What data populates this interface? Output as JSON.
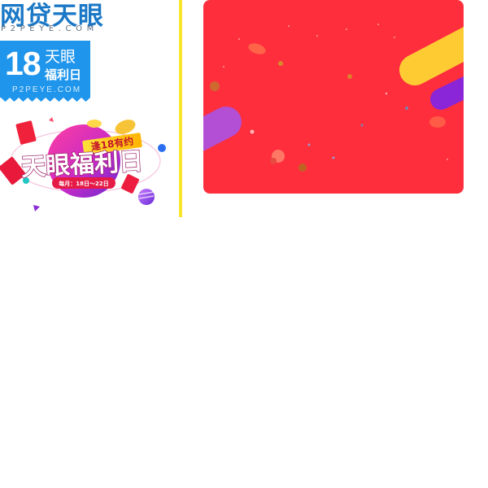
{
  "logo": {
    "main_text": "网贷天眼",
    "sub_text": "P2PEYE.COM"
  },
  "badge": {
    "number": "18",
    "line1": "天眼",
    "line2": "福利日",
    "domain": "P2PEYE.COM",
    "color": "#1f95ec"
  },
  "promo": {
    "tag": "逢18有约",
    "title": "天眼福利日",
    "date": "每月：18日～22日"
  },
  "divider": {
    "color": "#f9e52c"
  },
  "banner": {
    "background": "#fe2e3d",
    "stripe_colors": [
      "#fecb33",
      "#8a26d8",
      "#b24fd4"
    ]
  }
}
